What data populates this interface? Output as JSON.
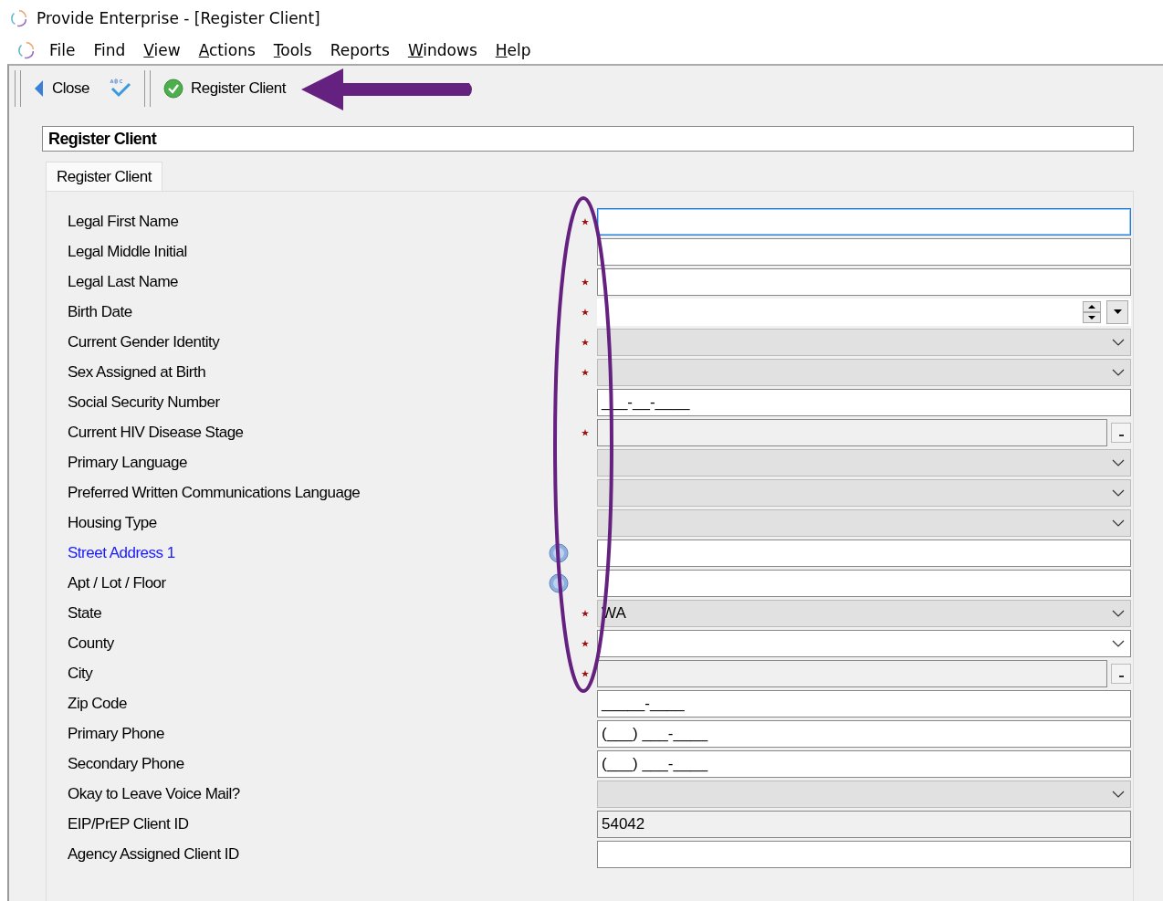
{
  "window": {
    "title": "Provide Enterprise - [Register Client]"
  },
  "menu": [
    {
      "label": "File",
      "accelerator": false
    },
    {
      "label": "Find",
      "accelerator": false
    },
    {
      "label": "View",
      "accelerator": true
    },
    {
      "label": "Actions",
      "accelerator": true
    },
    {
      "label": "Tools",
      "accelerator": true
    },
    {
      "label": "Reports",
      "accelerator": false
    },
    {
      "label": "Windows",
      "accelerator": true
    },
    {
      "label": "Help",
      "accelerator": true
    }
  ],
  "toolbar": [
    {
      "kind": "back",
      "label": "Close"
    },
    {
      "kind": "spell"
    },
    {
      "kind": "separator"
    },
    {
      "kind": "check",
      "label": "Register Client"
    }
  ],
  "header": "Register Client",
  "tabs": [
    {
      "label": "Register Client",
      "selected": true
    }
  ],
  "fields": [
    {
      "label": "Legal First Name",
      "kind": "text",
      "required": true,
      "help": false,
      "link": false,
      "focused": true
    },
    {
      "label": "Legal Middle Initial",
      "kind": "text",
      "required": false,
      "help": false,
      "link": false
    },
    {
      "label": "Legal Last Name",
      "kind": "text",
      "required": true,
      "help": false,
      "link": false
    },
    {
      "label": "Birth Date",
      "kind": "date",
      "required": true,
      "help": false,
      "link": false
    },
    {
      "label": "Current Gender Identity",
      "kind": "combo",
      "required": true,
      "help": false,
      "link": false
    },
    {
      "label": "Sex Assigned at Birth",
      "kind": "combo",
      "required": true,
      "help": false,
      "link": false
    },
    {
      "label": "Social Security Number",
      "kind": "text",
      "value": "___-__-____",
      "required": false,
      "help": false,
      "link": false
    },
    {
      "label": "Current HIV Disease Stage",
      "kind": "lookup",
      "required": true,
      "help": false,
      "link": false
    },
    {
      "label": "Primary Language",
      "kind": "combo",
      "required": false,
      "help": false,
      "link": false
    },
    {
      "label": "Preferred Written Communications Language",
      "kind": "combo",
      "required": false,
      "help": false,
      "link": false
    },
    {
      "label": "Housing Type",
      "kind": "combo",
      "required": false,
      "help": false,
      "link": false
    },
    {
      "label": "Street Address 1",
      "kind": "text",
      "required": false,
      "help": true,
      "link": true
    },
    {
      "label": "Apt / Lot / Floor",
      "kind": "text",
      "required": false,
      "help": true,
      "link": false
    },
    {
      "label": "State",
      "kind": "combo",
      "value": "WA",
      "required": true,
      "help": false,
      "link": false
    },
    {
      "label": "County",
      "kind": "combo-white",
      "required": true,
      "help": false,
      "link": false
    },
    {
      "label": "City",
      "kind": "lookup",
      "required": true,
      "help": false,
      "link": false
    },
    {
      "label": "Zip Code",
      "kind": "text",
      "value": "_____-____",
      "required": false,
      "help": false,
      "link": false
    },
    {
      "label": "Primary Phone",
      "kind": "text",
      "value": "(___) ___-____",
      "required": false,
      "help": false,
      "link": false
    },
    {
      "label": "Secondary Phone",
      "kind": "text",
      "value": "(___) ___-____",
      "required": false,
      "help": false,
      "link": false
    },
    {
      "label": "Okay to Leave Voice Mail?",
      "kind": "combo",
      "required": false,
      "help": false,
      "link": false
    },
    {
      "label": "EIP/PrEP Client ID",
      "kind": "readonly",
      "value": "54042",
      "required": false,
      "help": false,
      "link": false
    },
    {
      "label": "Agency Assigned Client ID",
      "kind": "text",
      "required": false,
      "help": false,
      "link": false
    }
  ]
}
